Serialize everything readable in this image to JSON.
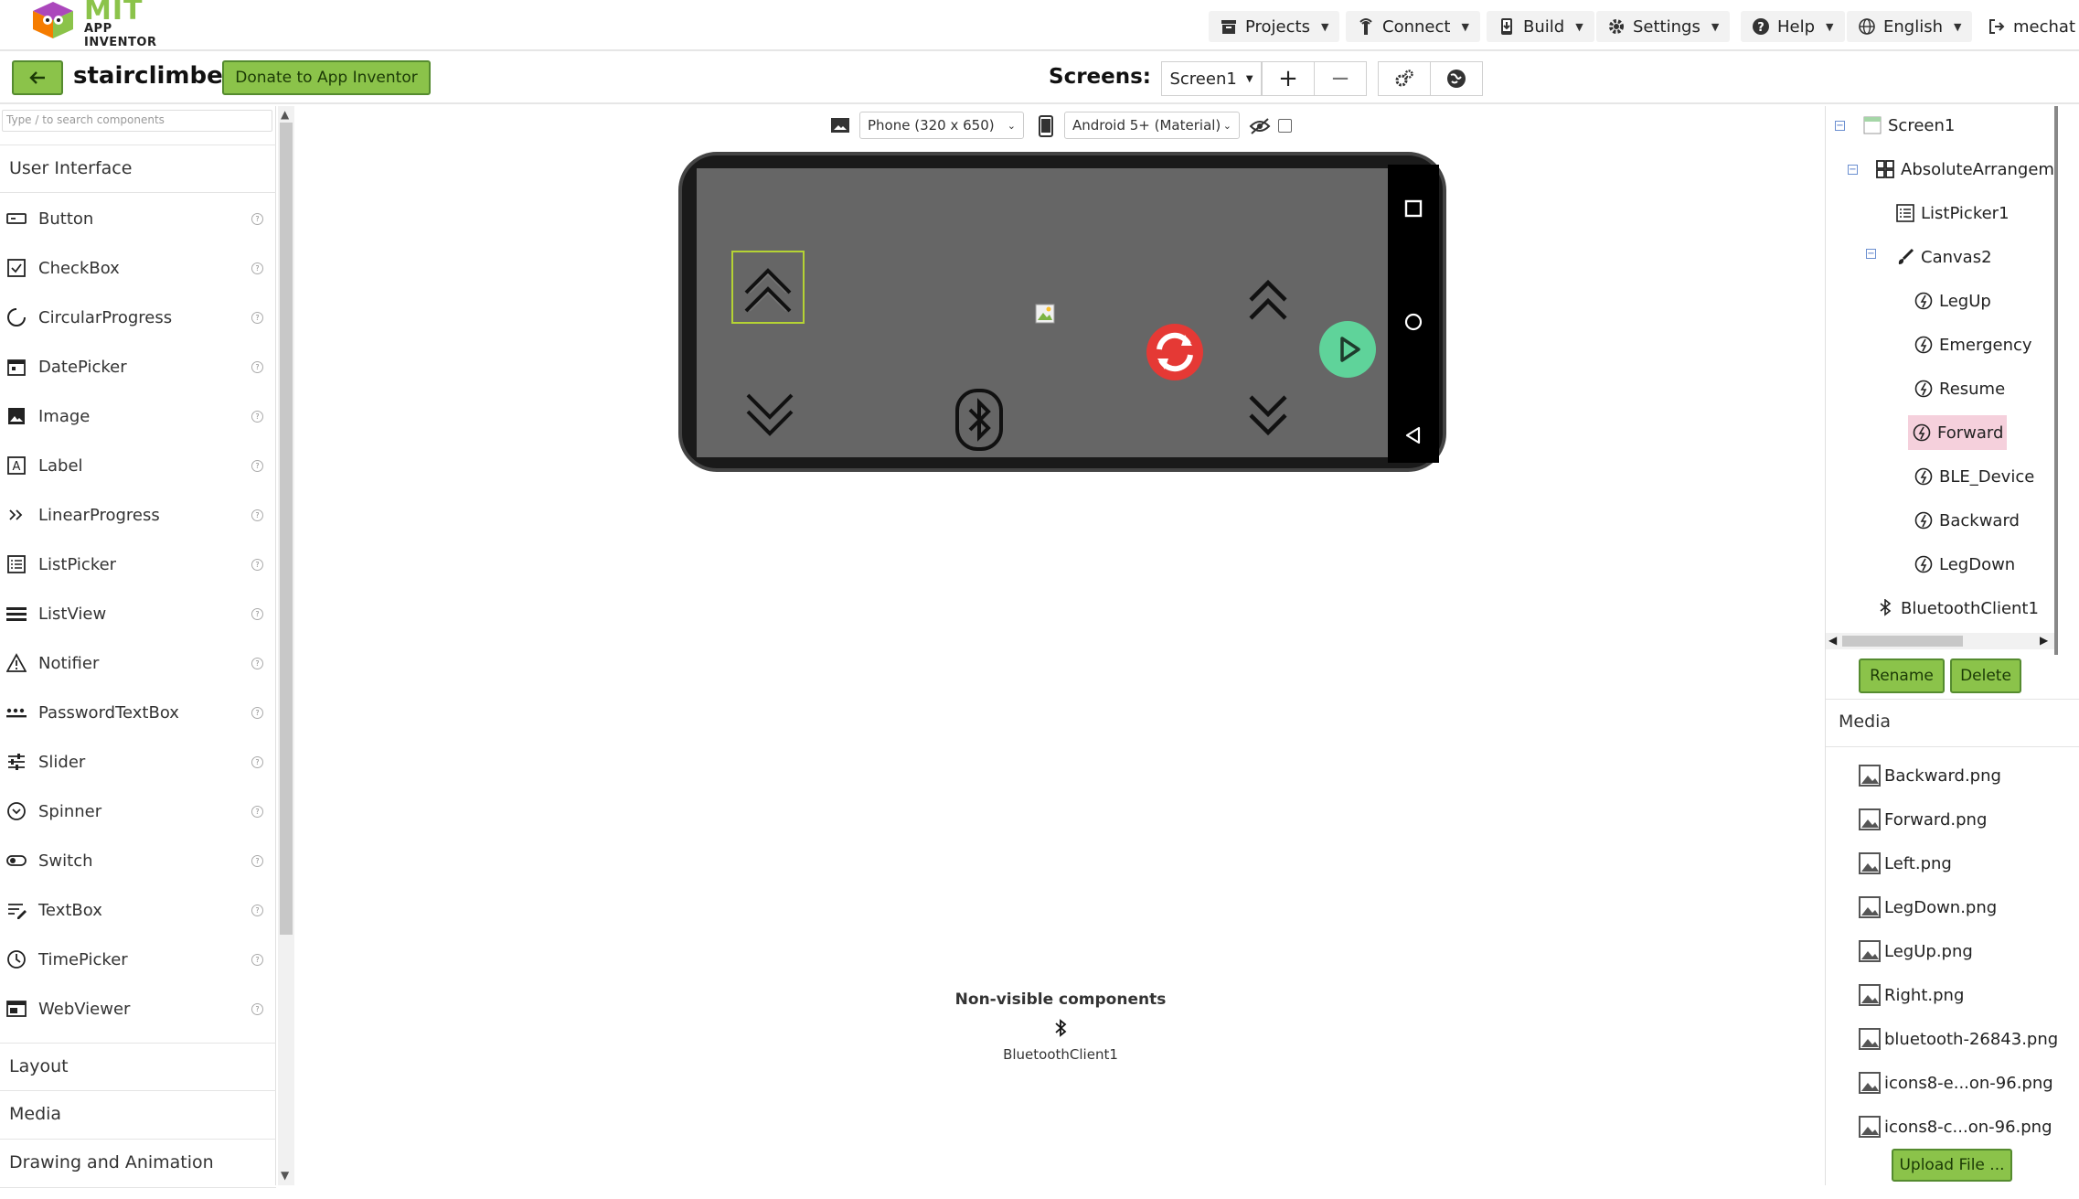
{
  "app": {
    "logo_top": "MIT",
    "logo_bottom": "APP INVENTOR"
  },
  "topnav": [
    {
      "label": "Projects",
      "icon": "projects-icon"
    },
    {
      "label": "Connect",
      "icon": "connect-icon"
    },
    {
      "label": "Build",
      "icon": "build-icon"
    },
    {
      "label": "Settings",
      "icon": "gear-icon"
    },
    {
      "label": "Help",
      "icon": "help-icon"
    },
    {
      "label": "English",
      "icon": "globe-icon"
    },
    {
      "label": "mechat",
      "icon": "logout-icon"
    }
  ],
  "project": {
    "name": "stairclimber",
    "donate_label": "Donate to App Inventor",
    "screens_label": "Screens:",
    "screen_selected": "Screen1",
    "add_screen": "+",
    "remove_screen": "−"
  },
  "palette": {
    "search_placeholder": "Type / to search components",
    "category_open": "User Interface",
    "items": [
      "Button",
      "CheckBox",
      "CircularProgress",
      "DatePicker",
      "Image",
      "Label",
      "LinearProgress",
      "ListPicker",
      "ListView",
      "Notifier",
      "PasswordTextBox",
      "Slider",
      "Spinner",
      "Switch",
      "TextBox",
      "TimePicker",
      "WebViewer"
    ],
    "other_categories": [
      "Layout",
      "Media",
      "Drawing and Animation"
    ]
  },
  "viewer": {
    "device_size": "Phone (320 x 650)",
    "theme": "Android 5+ (Material)",
    "nonvisible_title": "Non-visible components",
    "nonvisible_items": [
      "BluetoothClient1"
    ]
  },
  "components": {
    "tree": [
      {
        "label": "Screen1",
        "level": 0,
        "toggle": "−"
      },
      {
        "label": "AbsoluteArrangem",
        "level": 1,
        "toggle": "−"
      },
      {
        "label": "ListPicker1",
        "level": 2
      },
      {
        "label": "Canvas2",
        "level": 2,
        "toggle": "−"
      },
      {
        "label": "LegUp",
        "level": 3
      },
      {
        "label": "Emergency",
        "level": 3
      },
      {
        "label": "Resume",
        "level": 3
      },
      {
        "label": "Forward",
        "level": 3,
        "selected": true
      },
      {
        "label": "BLE_Device",
        "level": 3
      },
      {
        "label": "Backward",
        "level": 3
      },
      {
        "label": "LegDown",
        "level": 3
      },
      {
        "label": "BluetoothClient1",
        "level": 1
      }
    ],
    "rename_label": "Rename",
    "delete_label": "Delete"
  },
  "media": {
    "title": "Media",
    "files": [
      "Backward.png",
      "Forward.png",
      "Left.png",
      "LegDown.png",
      "LegUp.png",
      "Right.png",
      "bluetooth-26843.png",
      "icons8-e...on-96.png",
      "icons8-c...on-96.png"
    ],
    "upload_label": "Upload File ..."
  },
  "colors": {
    "accent_green": "#8bc34a",
    "phone_screen": "#666666",
    "selected_row": "#f5d0dc",
    "play_green": "#5fd39a",
    "emergency_red": "#e53935"
  }
}
